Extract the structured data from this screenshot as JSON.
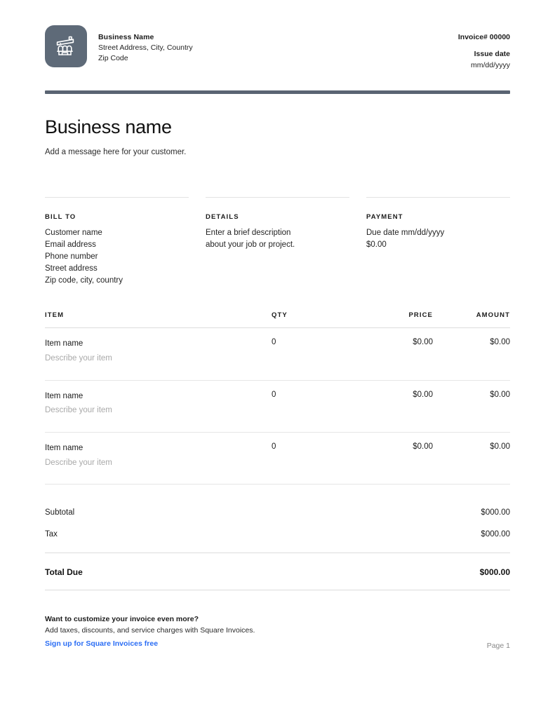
{
  "theme": {
    "accent_bar": "#5a6472",
    "logo_tile": "#5e6a78",
    "link_color": "#2a6df4",
    "muted_text": "#a9a9a9",
    "rule_color": "#dcdcdc"
  },
  "header": {
    "logo_icon": "storefront-icon",
    "business_name": "Business Name",
    "address_line_1": "Street Address, City, Country",
    "address_line_2": "Zip Code",
    "invoice_number": "Invoice# 00000",
    "issue_date_label": "Issue date",
    "issue_date_value": "mm/dd/yyyy"
  },
  "title_block": {
    "title": "Business name",
    "message": "Add a message here for your customer."
  },
  "info_columns": [
    {
      "heading": "BILL TO",
      "lines": [
        "Customer name",
        "Email address",
        "Phone number",
        "Street address",
        "Zip code, city, country"
      ]
    },
    {
      "heading": "DETAILS",
      "lines": [
        "Enter a brief description",
        "about your job or project."
      ]
    },
    {
      "heading": "PAYMENT",
      "lines": [
        "Due date mm/dd/yyyy",
        "$0.00"
      ]
    }
  ],
  "items_table": {
    "columns": {
      "item": "ITEM",
      "qty": "QTY",
      "price": "PRICE",
      "amount": "AMOUNT"
    },
    "rows": [
      {
        "name": "Item name",
        "description": "Describe your item",
        "qty": "0",
        "price": "$0.00",
        "amount": "$0.00"
      },
      {
        "name": "Item name",
        "description": "Describe your item",
        "qty": "0",
        "price": "$0.00",
        "amount": "$0.00"
      },
      {
        "name": "Item name",
        "description": "Describe your item",
        "qty": "0",
        "price": "$0.00",
        "amount": "$0.00"
      }
    ]
  },
  "totals": {
    "subtotal_label": "Subtotal",
    "subtotal_value": "$000.00",
    "tax_label": "Tax",
    "tax_value": "$000.00",
    "total_label": "Total Due",
    "total_value": "$000.00"
  },
  "footer": {
    "promo_title": "Want to customize your invoice even more?",
    "promo_body": "Add taxes, discounts, and service charges with Square Invoices.",
    "promo_link": "Sign up for Square Invoices free",
    "page_number": "Page 1"
  }
}
